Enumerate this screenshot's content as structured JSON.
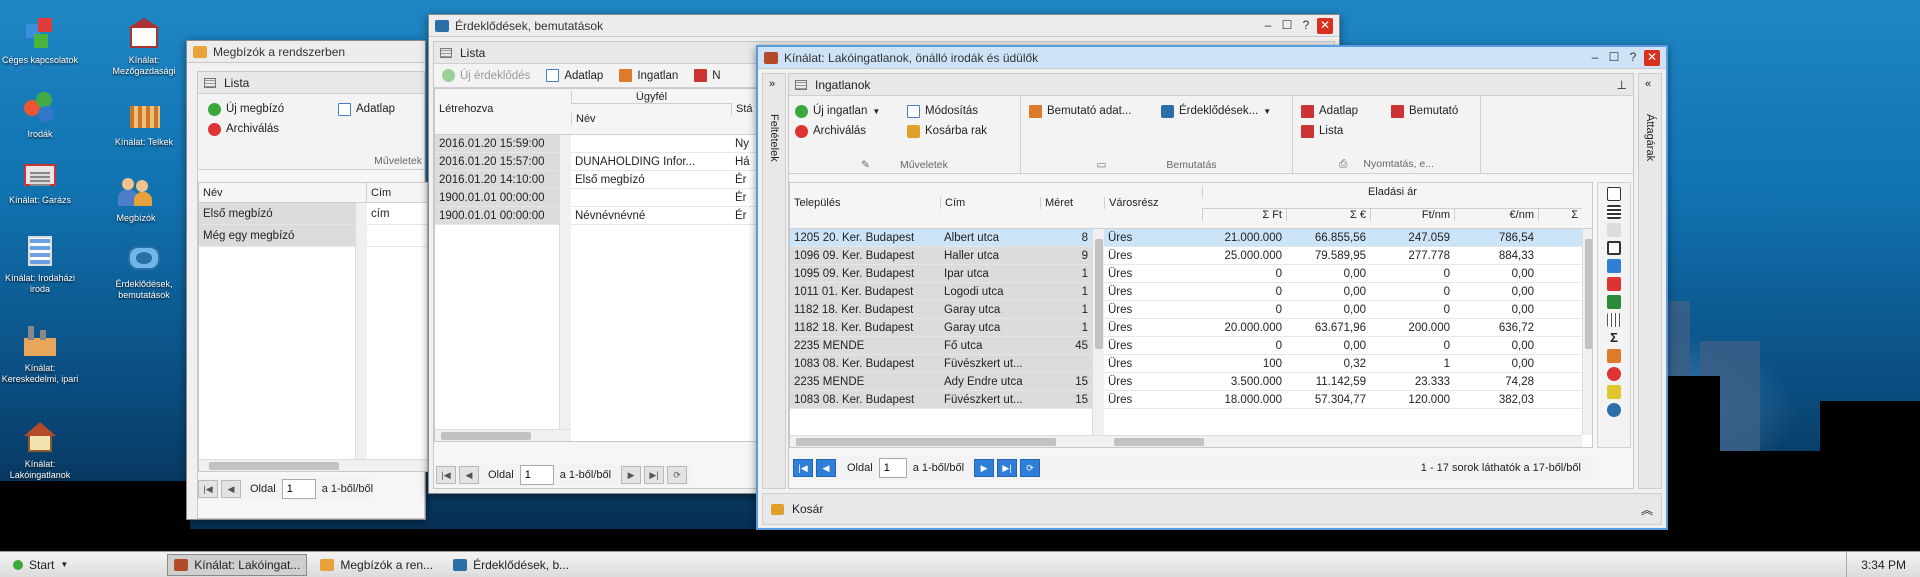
{
  "desktop": {
    "icons": [
      {
        "label": "Céges kapcsolatok",
        "icon": "cubes-icon"
      },
      {
        "label": "Kínálat: Mezőgazdasági",
        "icon": "barn-icon"
      },
      {
        "label": "Irodák",
        "icon": "balls-icon"
      },
      {
        "label": "Kínálat: Telkek",
        "icon": "land-plot-icon"
      },
      {
        "label": "Kínálat: Garázs",
        "icon": "garage-icon"
      },
      {
        "label": "Megbízók",
        "icon": "people-icon"
      },
      {
        "label": "Kínálat: Irodaházi iroda",
        "icon": "office-building-icon"
      },
      {
        "label": "Érdeklődések, bemutatások",
        "icon": "telephone-icon"
      },
      {
        "label": "Kínálat: Kereskedelmi, ipari",
        "icon": "factory-icon"
      },
      {
        "label": "Kínálat: Lakóingatlanok",
        "icon": "house-icon"
      }
    ]
  },
  "win_megbizok": {
    "title": "Megbízók a rendszerben",
    "panel_title": "Lista",
    "actions": {
      "new": "Új megbízó",
      "archive": "Archiválás",
      "sheet": "Adatlap"
    },
    "group_label": "Műveletek",
    "columns": [
      "Név",
      "Cím"
    ],
    "rows": [
      {
        "name": "Első megbízó",
        "addr": "cím"
      },
      {
        "name": "Még egy megbízó",
        "addr": ""
      }
    ],
    "pager": {
      "label": "Oldal",
      "page": "1",
      "of": "a 1-ből/ből"
    }
  },
  "win_erdeklodes": {
    "title": "Érdeklődések, bemutatások",
    "panel_title": "Lista",
    "actions": {
      "new": "Új érdeklődés",
      "sheet": "Adatlap",
      "property": "Ingatlan",
      "more": "N"
    },
    "columns": {
      "created": "Létrehozva",
      "client": "Ügyfél",
      "name": "Név",
      "status": "Stá"
    },
    "rows": [
      {
        "created": "2016.01.20 15:59:00",
        "name": "",
        "status": "Ny"
      },
      {
        "created": "2016.01.20 15:57:00",
        "name": "DUNAHOLDING Infor...",
        "status": "Há"
      },
      {
        "created": "2016.01.20 14:10:00",
        "name": "Első megbízó",
        "status": "Ér"
      },
      {
        "created": "1900.01.01 00:00:00",
        "name": "",
        "status": "Ér"
      },
      {
        "created": "1900.01.01 00:00:00",
        "name": "Névnévnévné",
        "status": "Ér"
      }
    ],
    "pager": {
      "label": "Oldal",
      "page": "1",
      "of": "a 1-ből/ből"
    }
  },
  "win_kinalat": {
    "title": "Kínálat: Lakóingatlanok, önálló irodák és üdülők",
    "panel_title": "Ingatlanok",
    "left_tab": "Feltételek",
    "right_tab": "Áttagárak",
    "actions": {
      "new": "Új ingatlan",
      "modify": "Módosítás",
      "archive": "Archiválás",
      "cart": "Kosárba rak",
      "group1": "Műveletek",
      "show_data": "Bemutató adat...",
      "interest": "Érdeklődések...",
      "group2": "Bemutatás",
      "sheet": "Adatlap",
      "show": "Bemutató",
      "list": "Lista",
      "group3": "Nyomtatás, e..."
    },
    "columns": {
      "settlement": "Település",
      "street": "Cím",
      "size": "Méret",
      "district": "Városrész",
      "price_group": "Eladási ár",
      "ft": "Σ Ft",
      "eur": "Σ €",
      "ftnm": "Ft/nm",
      "eurnm": "€/nm",
      "extra": "Σ"
    },
    "rows": [
      {
        "settlement": "1205 20. Ker. Budapest",
        "street": "Albert utca",
        "size": "8",
        "district": "Üres",
        "ft": "21.000.000",
        "eur": "66.855,56",
        "ftnm": "247.059",
        "eurnm": "786,54"
      },
      {
        "settlement": "1096 09. Ker. Budapest",
        "street": "Haller utca",
        "size": "9",
        "district": "Üres",
        "ft": "25.000.000",
        "eur": "79.589,95",
        "ftnm": "277.778",
        "eurnm": "884,33"
      },
      {
        "settlement": "1095 09. Ker. Budapest",
        "street": "Ipar utca",
        "size": "1",
        "district": "Üres",
        "ft": "0",
        "eur": "0,00",
        "ftnm": "0",
        "eurnm": "0,00"
      },
      {
        "settlement": "1011 01. Ker. Budapest",
        "street": "Logodi utca",
        "size": "1",
        "district": "Üres",
        "ft": "0",
        "eur": "0,00",
        "ftnm": "0",
        "eurnm": "0,00"
      },
      {
        "settlement": "1182 18. Ker. Budapest",
        "street": "Garay utca",
        "size": "1",
        "district": "Üres",
        "ft": "0",
        "eur": "0,00",
        "ftnm": "0",
        "eurnm": "0,00"
      },
      {
        "settlement": "1182 18. Ker. Budapest",
        "street": "Garay utca",
        "size": "1",
        "district": "Üres",
        "ft": "20.000.000",
        "eur": "63.671,96",
        "ftnm": "200.000",
        "eurnm": "636,72"
      },
      {
        "settlement": "2235 MENDE",
        "street": "Fő utca",
        "size": "45",
        "district": "Üres",
        "ft": "0",
        "eur": "0,00",
        "ftnm": "0",
        "eurnm": "0,00"
      },
      {
        "settlement": "1083 08. Ker. Budapest",
        "street": "Füvészkert ut...",
        "size": "",
        "district": "Üres",
        "ft": "100",
        "eur": "0,32",
        "ftnm": "1",
        "eurnm": "0,00"
      },
      {
        "settlement": "2235 MENDE",
        "street": "Ady Endre utca",
        "size": "15",
        "district": "Üres",
        "ft": "3.500.000",
        "eur": "11.142,59",
        "ftnm": "23.333",
        "eurnm": "74,28"
      },
      {
        "settlement": "1083 08. Ker. Budapest",
        "street": "Füvészkert ut...",
        "size": "15",
        "district": "Üres",
        "ft": "18.000.000",
        "eur": "57.304,77",
        "ftnm": "120.000",
        "eurnm": "382,03"
      }
    ],
    "pager": {
      "label": "Oldal",
      "page": "1",
      "of": "a 1-ből/ből",
      "status": "1 - 17 sorok láthatók a 17-ből/ből"
    },
    "cart_label": "Kosár"
  },
  "taskbar": {
    "start": "Start",
    "tasks": [
      "Kínálat: Lakóingat...",
      "Megbízók a ren...",
      "Érdeklődések, b..."
    ],
    "clock": "3:34 PM"
  },
  "colors": {
    "accent": "#2f7ed8",
    "close": "#d9301e",
    "row_grey": "#dcdcdc",
    "row_selected": "#cce4f7"
  }
}
